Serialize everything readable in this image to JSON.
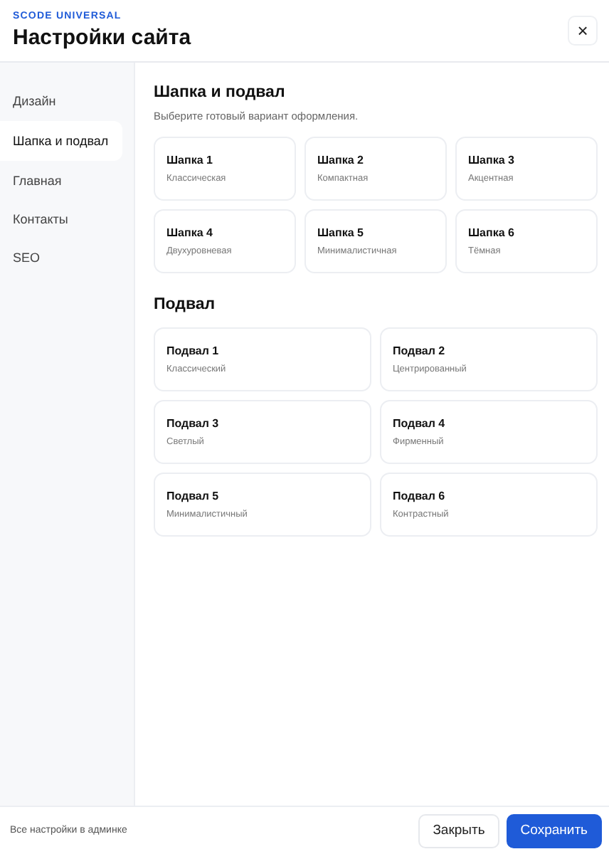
{
  "header": {
    "brand": "SCODE UNIVERSAL",
    "title": "Настройки сайта",
    "close": "×"
  },
  "sidebar": {
    "items": [
      {
        "label": "Дизайн",
        "selected": false
      },
      {
        "label": "Шапка и подвал",
        "selected": true
      },
      {
        "label": "Главная",
        "selected": false
      },
      {
        "label": "Контакты",
        "selected": false
      },
      {
        "label": "SEO",
        "selected": false
      }
    ]
  },
  "sections": [
    {
      "title": "Шапка и подвал",
      "subtitle": "Выберите готовый вариант оформления.",
      "kind": "wide",
      "options": [
        {
          "name": "Шапка 1",
          "description": "Классическая"
        },
        {
          "name": "Шапка 2",
          "description": "Компактная"
        },
        {
          "name": "Шапка 3",
          "description": "Акцентная"
        },
        {
          "name": "Шапка 4",
          "description": "Двухуровневая"
        },
        {
          "name": "Шапка 5",
          "description": "Минималистичная"
        },
        {
          "name": "Шапка 6",
          "description": "Тёмная"
        }
      ]
    },
    {
      "title": "Подвал",
      "kind": "narrow",
      "options": [
        {
          "name": "Подвал 1",
          "description": "Классический"
        },
        {
          "name": "Подвал 2",
          "description": "Центрированный"
        },
        {
          "name": "Подвал 3",
          "description": "Светлый"
        },
        {
          "name": "Подвал 4",
          "description": "Фирменный"
        },
        {
          "name": "Подвал 5",
          "description": "Минималистичный"
        },
        {
          "name": "Подвал 6",
          "description": "Контрастный"
        }
      ]
    }
  ],
  "footer": {
    "note": "Все настройки в админке",
    "buttons": [
      {
        "label": "Закрыть",
        "kind": "secondary"
      },
      {
        "label": "Сохранить",
        "kind": "primary"
      }
    ]
  }
}
